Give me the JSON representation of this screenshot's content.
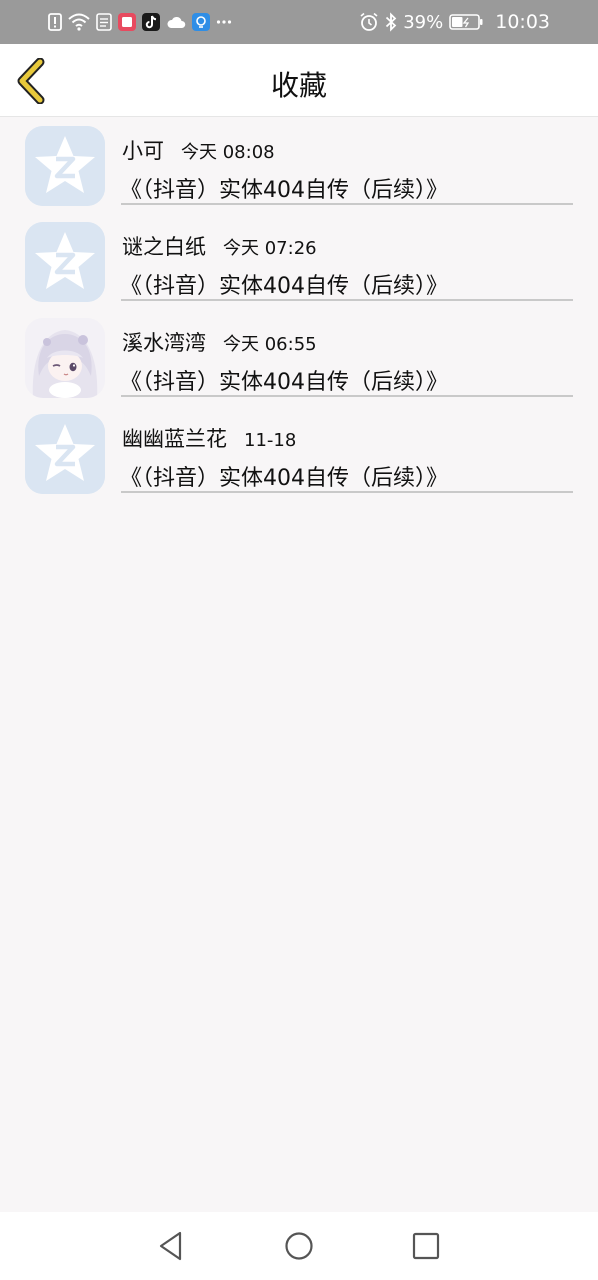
{
  "status_bar": {
    "battery": "39%",
    "time": "10:03",
    "notification_icons": [
      "alert-icon",
      "wifi-icon",
      "sim-icon",
      "red-app-icon",
      "tiktok-icon",
      "cloud-icon",
      "bulb-app-icon",
      "more-icon"
    ]
  },
  "header": {
    "title": "收藏",
    "accent_color": "#e8c93b"
  },
  "favorites": [
    {
      "name": "小可",
      "time": "今天 08:08",
      "work": "《（抖音）实体404自传（后续）》",
      "avatar": "qzone-star-icon"
    },
    {
      "name": "谜之白纸",
      "time": "今天 07:26",
      "work": "《（抖音）实体404自传（后续）》",
      "avatar": "qzone-star-icon"
    },
    {
      "name": "溪水湾湾",
      "time": "今天 06:55",
      "work": "《（抖音）实体404自传（后续）》",
      "avatar": "anime-girl-avatar"
    },
    {
      "name": "幽幽蓝兰花",
      "time": "11-18",
      "work": "《（抖音）实体404自传（后续）》",
      "avatar": "qzone-star-icon"
    }
  ],
  "nav_bar": {
    "buttons": [
      "back-triangle-icon",
      "home-circle-icon",
      "recents-square-icon"
    ]
  }
}
